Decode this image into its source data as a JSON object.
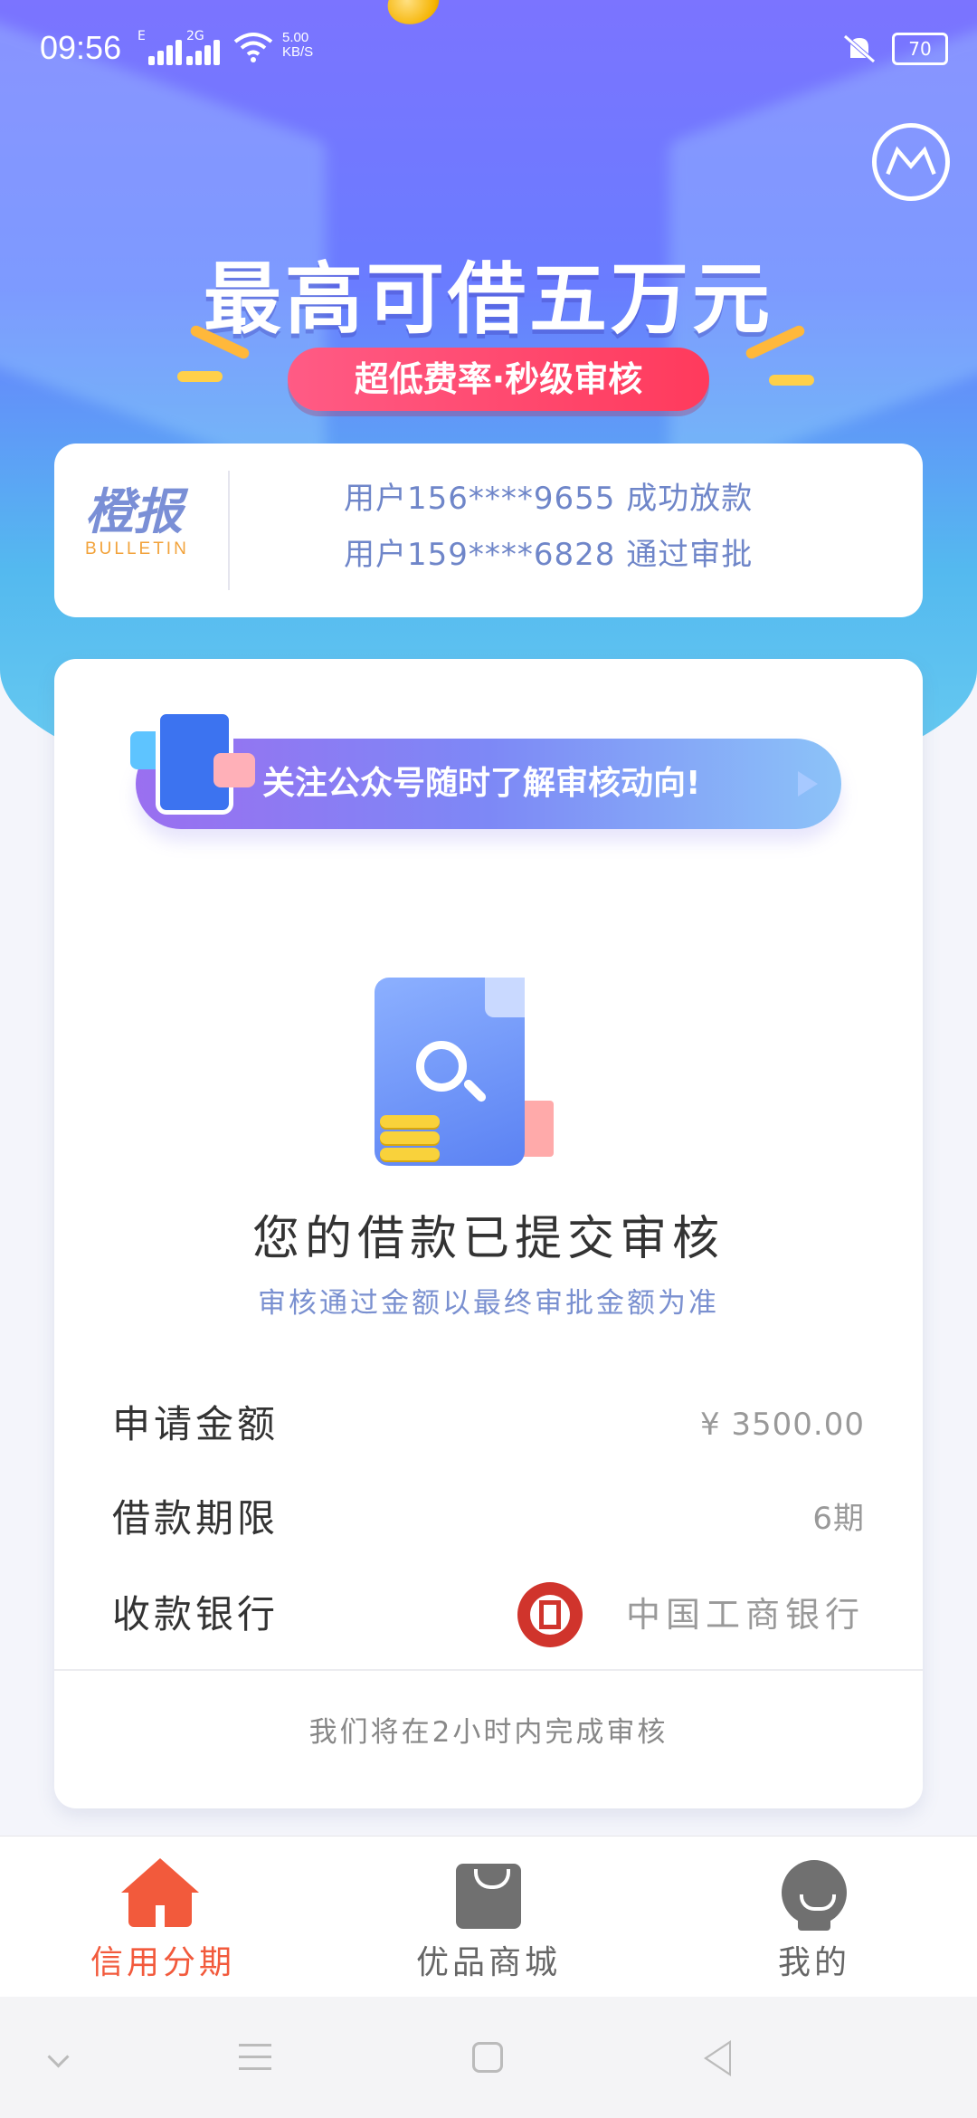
{
  "status_bar": {
    "time": "09:56",
    "sim1_type": "E",
    "sim2_type": "2G",
    "net_speed_value": "5.00",
    "net_speed_unit": "KB/S",
    "battery": "70"
  },
  "header": {
    "headline": "最高可借五万元",
    "pill": "超低费率·秒级审核"
  },
  "bulletin": {
    "logo_cn": "橙报",
    "logo_en": "BULLETIN",
    "lines": [
      "用户156****9655 成功放款",
      "用户159****6828 通过审批"
    ]
  },
  "banner": {
    "text": "关注公众号随时了解审核动向!"
  },
  "status_card": {
    "title": "您的借款已提交审核",
    "subtitle": "审核通过金额以最终审批金额为准",
    "rows": [
      {
        "label": "申请金额",
        "value": "¥ 3500.00"
      },
      {
        "label": "借款期限",
        "value": "6期"
      },
      {
        "label": "收款银行",
        "value": "中国工商银行"
      }
    ],
    "footer": "我们将在2小时内完成审核"
  },
  "tabbar": {
    "items": [
      {
        "label": "信用分期",
        "icon": "home-icon",
        "active": true
      },
      {
        "label": "优品商城",
        "icon": "bag-icon",
        "active": false
      },
      {
        "label": "我的",
        "icon": "profile-icon",
        "active": false
      }
    ]
  },
  "colors": {
    "accent": "#f25a3c",
    "brand_blue": "#6a7cff",
    "pill_red": "#ff3a5c",
    "bank_red": "#d0342c"
  }
}
